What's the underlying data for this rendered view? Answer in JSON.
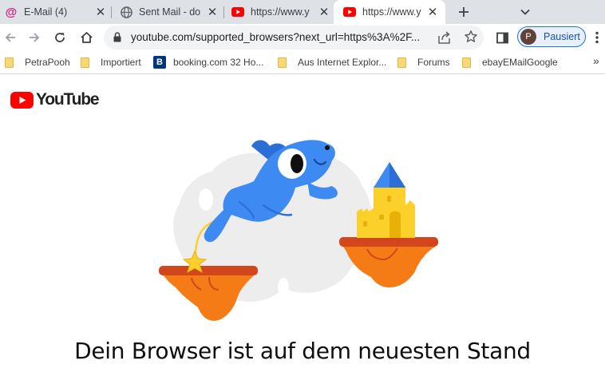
{
  "tabs": [
    {
      "title": "E-Mail (4)",
      "icon": "at-sign-icon"
    },
    {
      "title": "Sent Mail - do",
      "icon": "globe-icon"
    },
    {
      "title": "https://www.y",
      "icon": "youtube-icon"
    },
    {
      "title": "https://www.y",
      "icon": "youtube-icon",
      "active": true
    }
  ],
  "toolbar": {
    "url": "youtube.com/supported_browsers?next_url=https%3A%2F...",
    "profile_initial": "P",
    "profile_label": "Pausiert"
  },
  "bookmarks": [
    {
      "label": "PetraPooh",
      "icon": "folder-icon"
    },
    {
      "label": "Importiert",
      "icon": "folder-icon"
    },
    {
      "label": "booking.com 32 Ho...",
      "icon": "booking-icon",
      "icon_letter": "B"
    },
    {
      "label": "Aus Internet Explor...",
      "icon": "folder-icon"
    },
    {
      "label": "Forums",
      "icon": "folder-icon"
    },
    {
      "label": "ebayEMailGoogle",
      "icon": "folder-icon"
    }
  ],
  "page": {
    "logo_text": "YouTube",
    "headline": "Dein Browser ist auf dem neuesten Stand"
  },
  "colors": {
    "youtube_red": "#ff0000",
    "tabstrip_bg": "#dee1e6",
    "omnibox_bg": "#f1f3f4",
    "profile_accent": "#1a73e8",
    "dino_blue": "#3d8bf2",
    "island_orange": "#f06a1d",
    "castle_yellow": "#fcd02a"
  }
}
